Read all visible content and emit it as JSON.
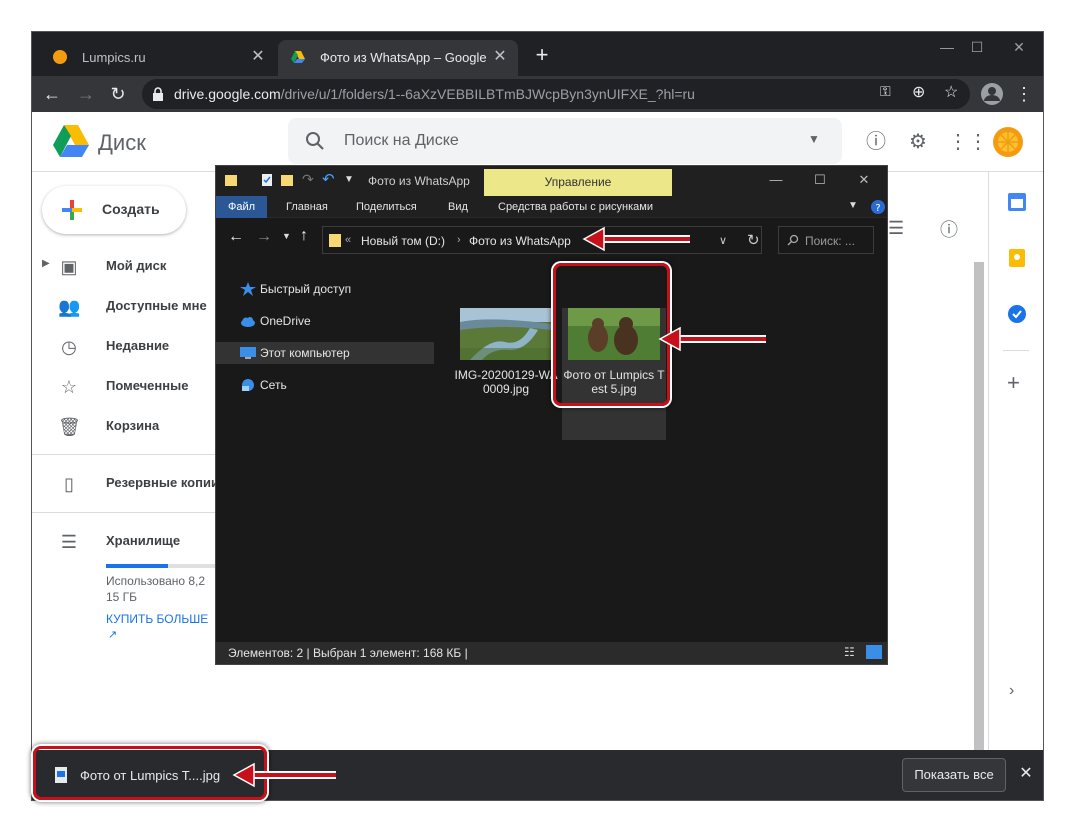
{
  "browser": {
    "tabs": [
      {
        "title": "Lumpics.ru"
      },
      {
        "title": "Фото из WhatsApp – Google Диск"
      }
    ],
    "url_host": "drive.google.com",
    "url_path": "/drive/u/1/folders/1--6aXzVEBBILBTmBJWcpByn3ynUIFXE_?hl=ru"
  },
  "drive": {
    "title": "Диск",
    "search_placeholder": "Поиск на Диске",
    "create_label": "Создать",
    "nav": [
      {
        "label": "Мой диск",
        "icon": "my-drive-icon"
      },
      {
        "label": "Доступные мне",
        "icon": "shared-icon"
      },
      {
        "label": "Недавние",
        "icon": "clock-icon"
      },
      {
        "label": "Помеченные",
        "icon": "star-icon"
      },
      {
        "label": "Корзина",
        "icon": "trash-icon"
      },
      {
        "label": "Резервные копии",
        "icon": "backup-icon"
      }
    ],
    "storage": {
      "label": "Хранилище",
      "used_line1": "Использовано 8,2",
      "used_line2": "15 ГБ",
      "buy": "КУПИТЬ БОЛЬШЕ"
    }
  },
  "download": {
    "file": "Фото от Lumpics T....jpg",
    "show_all": "Показать все"
  },
  "explorer": {
    "title": "Фото из WhatsApp",
    "manage_tab": "Управление",
    "ribbon": [
      "Файл",
      "Главная",
      "Поделиться",
      "Вид",
      "Средства работы с рисунками"
    ],
    "path": [
      "Новый том (D:)",
      "Фото из WhatsApp"
    ],
    "search_placeholder": "Поиск: ...",
    "sidebar": [
      "Быстрый доступ",
      "OneDrive",
      "Этот компьютер",
      "Сеть"
    ],
    "files": [
      {
        "name": "IMG-20200129-WA0009.jpg"
      },
      {
        "name": "Фото от Lumpics Test 5.jpg"
      }
    ],
    "status": "Элементов: 2   |   Выбран 1 элемент: 168 КБ   |"
  },
  "colors": {
    "annotation_red": "#c8101a",
    "manage_tab_bg": "#ece88a",
    "drive_blue": "#1a73e8"
  }
}
